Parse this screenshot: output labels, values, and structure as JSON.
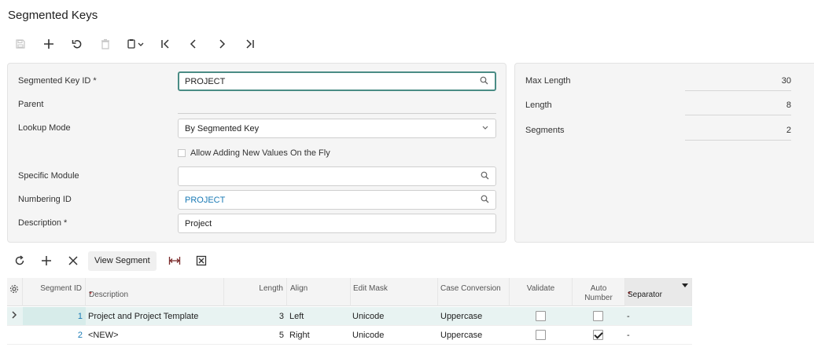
{
  "page": {
    "title": "Segmented Keys"
  },
  "toolbar": {
    "icons": [
      "save-icon",
      "add-icon",
      "undo-icon",
      "delete-icon",
      "copy-paste-icon",
      "first-record-icon",
      "previous-record-icon",
      "next-record-icon",
      "last-record-icon"
    ]
  },
  "form": {
    "segmented_key_id": {
      "label": "Segmented Key ID",
      "required": "*",
      "value": "PROJECT"
    },
    "parent": {
      "label": "Parent",
      "value": ""
    },
    "lookup_mode": {
      "label": "Lookup Mode",
      "value": "By Segmented Key"
    },
    "allow_adding": {
      "label": "Allow Adding New Values On the Fly",
      "checked": false
    },
    "specific_module": {
      "label": "Specific Module",
      "value": ""
    },
    "numbering_id": {
      "label": "Numbering ID",
      "value": "PROJECT"
    },
    "description": {
      "label": "Description",
      "required": "*",
      "value": "Project"
    }
  },
  "summary": {
    "max_length": {
      "label": "Max Length",
      "value": "30"
    },
    "length": {
      "label": "Length",
      "value": "8"
    },
    "segments": {
      "label": "Segments",
      "value": "2"
    }
  },
  "grid_toolbar": {
    "view_segment_label": "View Segment",
    "icons": [
      "refresh-icon",
      "add-row-icon",
      "delete-row-icon",
      "fit-columns-icon",
      "export-excel-icon"
    ]
  },
  "grid": {
    "columns": {
      "segment_id": "Segment ID",
      "description": "Description",
      "length": "Length",
      "align": "Align",
      "edit_mask": "Edit Mask",
      "case_conversion": "Case Conversion",
      "validate": "Validate",
      "auto_number": "Auto Number",
      "separator": "Separator",
      "required_mark": "*"
    },
    "rows": [
      {
        "segment_id": "1",
        "description": "Project and Project Template",
        "length": "3",
        "align": "Left",
        "edit_mask": "Unicode",
        "case_conversion": "Uppercase",
        "validate": false,
        "auto_number": false,
        "separator": "-"
      },
      {
        "segment_id": "2",
        "description": "<NEW>",
        "length": "5",
        "align": "Right",
        "edit_mask": "Unicode",
        "case_conversion": "Uppercase",
        "validate": false,
        "auto_number": true,
        "separator": "-"
      }
    ]
  }
}
